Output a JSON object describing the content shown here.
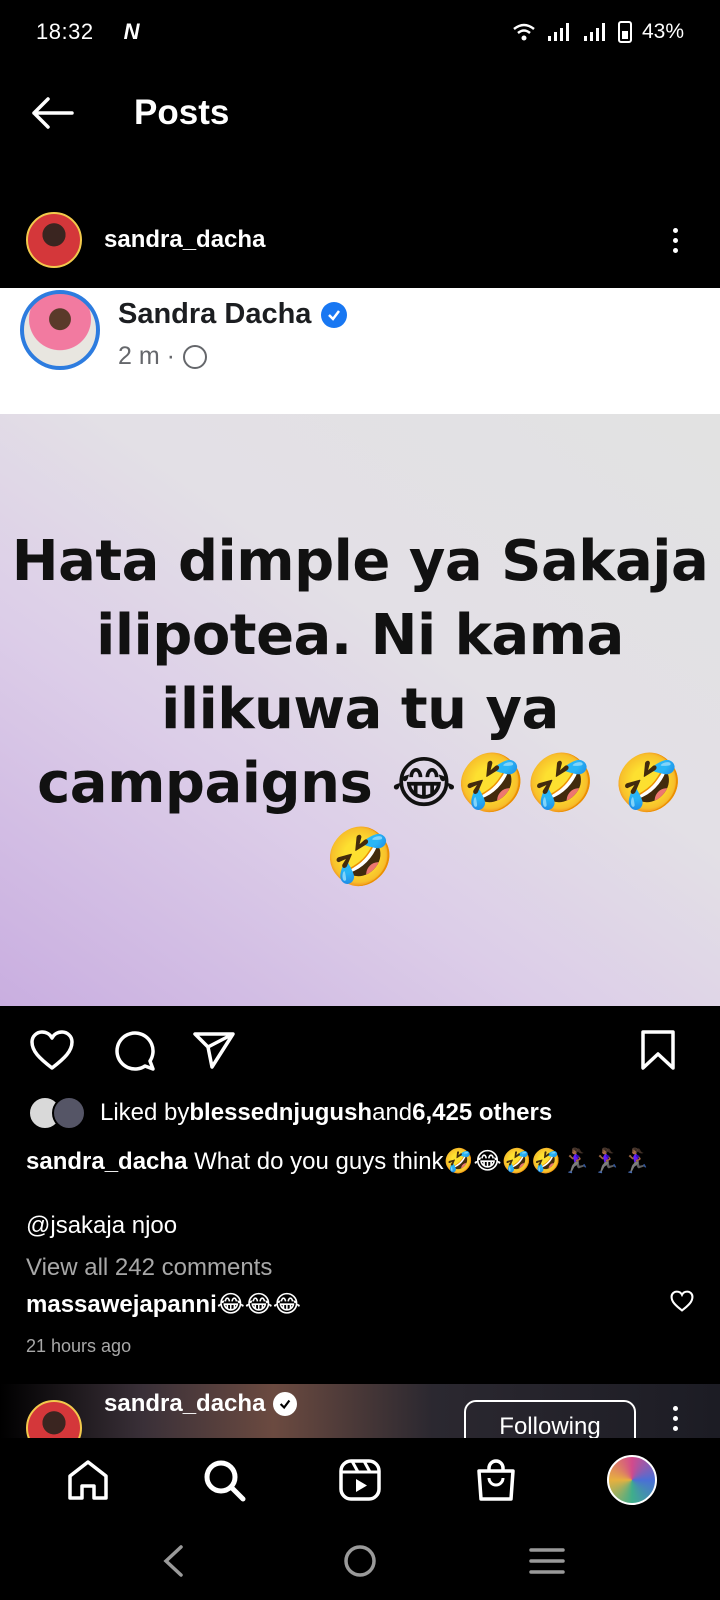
{
  "status_bar": {
    "time": "18:32",
    "carrier_icon": "N",
    "battery": "43%"
  },
  "header": {
    "title": "Posts"
  },
  "post": {
    "username": "sandra_dacha",
    "embed": {
      "name": "Sandra Dacha",
      "meta": "2 m ·"
    },
    "image_text": "Hata dimple ya Sakaja ilipotea. Ni kama ilikuwa tu ya campaigns 😂🤣🤣 🤣🤣",
    "likes": {
      "prefix": "Liked by ",
      "user": "blessednjugush",
      "mid": " and ",
      "count": "6,425 others"
    },
    "caption": {
      "user": "sandra_dacha",
      "text": " What do you guys think🤣😂🤣🤣🏃🏾‍♀️🏃🏾‍♀️🏃🏾‍♀️"
    },
    "mention": "@jsakaja njoo",
    "view_all": "View all 242 comments",
    "top_comment": {
      "user": "massawejapanni",
      "text": " 😂😂😂"
    },
    "timestamp": "21 hours ago"
  },
  "next_post": {
    "username": "sandra_dacha",
    "follow_label": "Following"
  },
  "icons": {
    "back": "arrow-left-icon",
    "more": "more-vertical-icon",
    "like": "heart-icon",
    "comment": "comment-icon",
    "share": "send-icon",
    "save": "bookmark-icon",
    "home": "home-icon",
    "search": "search-icon",
    "reels": "reels-icon",
    "shop": "shop-icon"
  },
  "colors": {
    "background": "#000000",
    "verified": "#1877f2",
    "muted": "#a8a8a8"
  }
}
